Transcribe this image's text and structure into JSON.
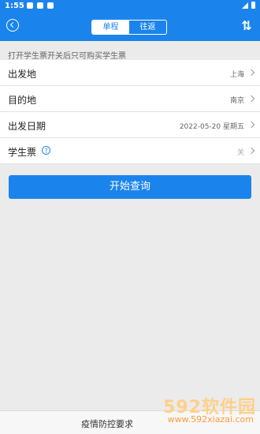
{
  "status": {
    "time": "1:55"
  },
  "header": {
    "tabs": [
      {
        "label": "单程",
        "active": true
      },
      {
        "label": "往返",
        "active": false
      }
    ]
  },
  "hint": "打开学生票开关后只可购买学生票",
  "form": {
    "rows": [
      {
        "label": "出发地",
        "value": "上海"
      },
      {
        "label": "目的地",
        "value": "南京"
      },
      {
        "label": "出发日期",
        "value": "2022-05-20 星期五"
      },
      {
        "label": "学生票",
        "value": "关"
      }
    ],
    "help": "?"
  },
  "button": {
    "search_label": "开始查询"
  },
  "footer": {
    "text": "疫情防控要求"
  },
  "watermark": {
    "brand": "592软件园",
    "url": "www.592xiazai.com"
  },
  "colors": {
    "primary": "#1b84ec",
    "background": "#ebebeb"
  }
}
